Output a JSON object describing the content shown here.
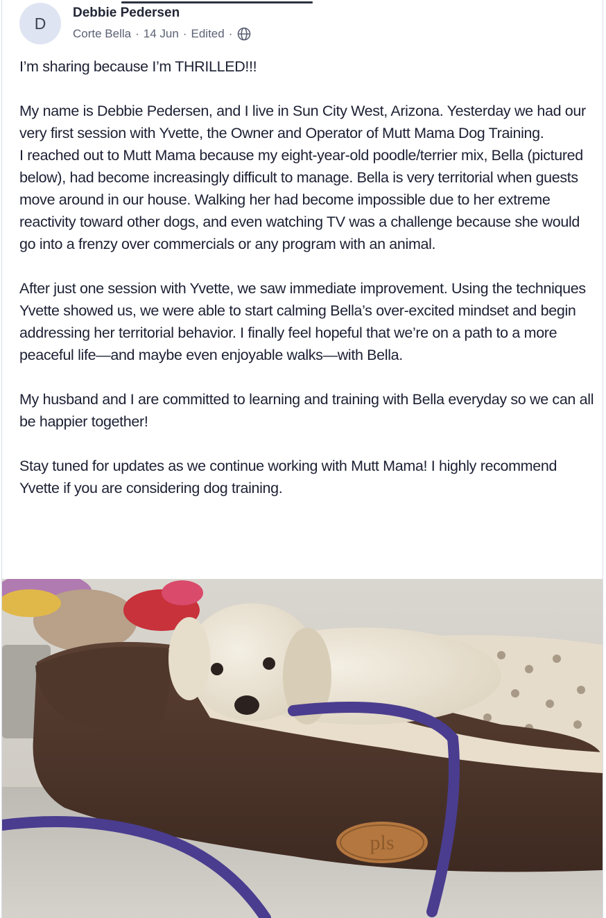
{
  "post": {
    "author": {
      "initial": "D",
      "name": "Debbie Pedersen"
    },
    "meta": {
      "location": "Corte Bella",
      "date": "14 Jun",
      "edited": "Edited",
      "separator": "·",
      "visibility_icon": "globe-icon"
    },
    "paragraphs": [
      "I’m sharing because I’m THRILLED!!!",
      "My name is Debbie Pedersen, and I live in Sun City West, Arizona. Yesterday we had our very first session with Yvette, the Owner and Operator of Mutt Mama Dog Training.\nI reached out to Mutt Mama because my eight-year-old poodle/terrier mix, Bella (pictured below), had become increasingly difficult to manage. Bella is very territorial when guests move around in our house. Walking her had become impossible due to her extreme reactivity toward other dogs, and even watching TV was a challenge because she would go into a frenzy over commercials or any program with an animal.",
      "After just one session with Yvette, we saw immediate improvement. Using the techniques Yvette showed us, we were able to start calming Bella’s over-excited mindset and begin addressing her territorial behavior. I finally feel hopeful that we’re on a path to a more peaceful life—and maybe even enjoyable walks—with Bella.",
      "My husband and I are committed to learning and training with Bella everyday so we can all be happier together!",
      "Stay tuned for updates as we continue working with Mutt Mama! I highly recommend Yvette if you are considering dog training."
    ],
    "photo": {
      "bed_logo_text": "pls"
    }
  },
  "colors": {
    "text": "#1c2033",
    "meta_text": "#5b6174",
    "avatar_bg": "#dfe4f2",
    "border": "#d7dbe6"
  }
}
